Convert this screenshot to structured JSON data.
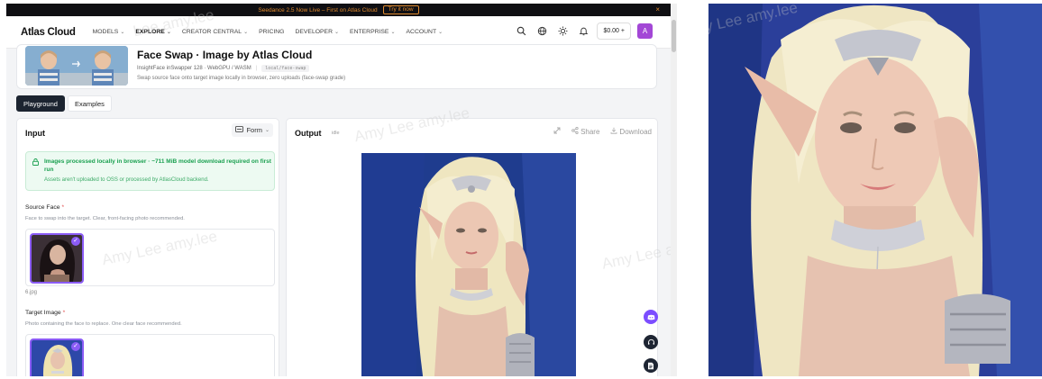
{
  "announcement": {
    "text": "Seedance 2.5 Now Live – First on Atlas Cloud",
    "cta": "Try it now",
    "close": "×"
  },
  "nav": {
    "logo": "Atlas Cloud",
    "items": [
      {
        "label": "MODELS",
        "has_menu": true
      },
      {
        "label": "EXPLORE",
        "has_menu": true,
        "active": true
      },
      {
        "label": "CREATOR CENTRAL",
        "has_menu": true
      },
      {
        "label": "PRICING",
        "has_menu": false
      },
      {
        "label": "DEVELOPER",
        "has_menu": true
      },
      {
        "label": "ENTERPRISE",
        "has_menu": true
      },
      {
        "label": "ACCOUNT",
        "has_menu": true
      }
    ],
    "balance": "$0.00 +",
    "avatar_letter": "A",
    "icons": [
      "search-icon",
      "globe-icon",
      "sun-icon",
      "bell-icon"
    ]
  },
  "model": {
    "title": "Face Swap · Image by Atlas Cloud",
    "meta": "InsightFace inSwapper 128 · WebGPU / WASM",
    "tag": "local/face-swap",
    "description": "Swap source face onto target image locally in browser, zero uploads (face-swap grade)"
  },
  "tabs": [
    "Playground",
    "Examples"
  ],
  "input": {
    "title": "Input",
    "form_button": "Form",
    "notice_title": "Images processed locally in browser · ~711 MiB model download required on first run",
    "notice_sub": "Assets aren't uploaded to OSS or processed by AtlasCloud backend.",
    "source_label": "Source Face",
    "source_help": "Face to swap into the target. Clear, front-facing photo recommended.",
    "source_file": "6.jpg",
    "target_label": "Target Image",
    "target_help": "Photo containing the face to replace. One clear face recommended.",
    "required_mark": "*"
  },
  "output": {
    "title": "Output",
    "status": "idle",
    "share": "Share",
    "download": "Download"
  },
  "watermarks": [
    "Lee amy.lee",
    "Amy Lee amy.lee",
    "Amy Lee amy.lee",
    "Amy Lee am",
    "Amy Lee amy.lee"
  ],
  "colors": {
    "accent": "#8b5cf6",
    "avatar": "#a347d6",
    "notice_green": "#1aa050",
    "announce_orange": "#e08a2e",
    "tab_active": "#1c2430"
  }
}
